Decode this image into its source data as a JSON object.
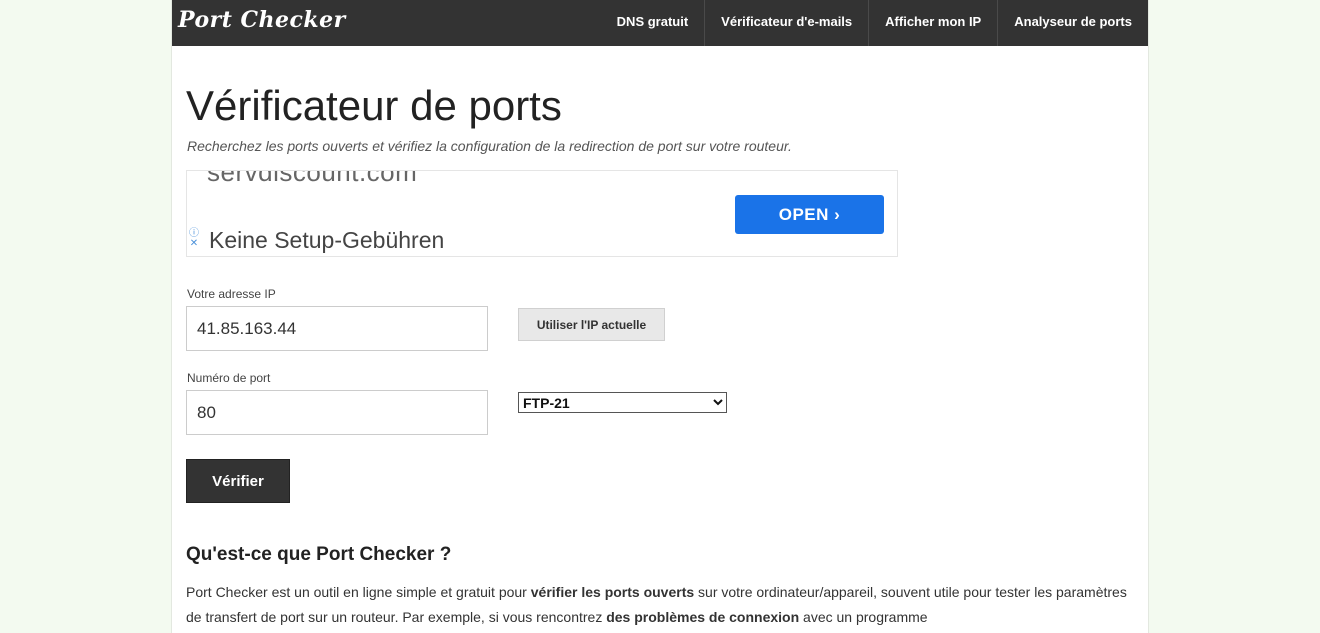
{
  "nav": {
    "logo": "Port Checker",
    "links": [
      "DNS gratuit",
      "Vérificateur d'e-mails",
      "Afficher mon IP",
      "Analyseur de ports"
    ]
  },
  "main": {
    "title": "Vérificateur de ports",
    "subtitle": "Recherchez les ports ouverts et vérifiez la configuration de la redirection de port sur votre routeur."
  },
  "ad": {
    "domain": "servdiscount.com",
    "headline": "Keine Setup-Gebühren",
    "open_label": "OPEN ›",
    "info_icon": "info-icon",
    "close_icon": "close-icon",
    "accent": "#1a73e8"
  },
  "form": {
    "ip_label": "Votre adresse IP",
    "ip_value": "41.85.163.44",
    "use_current_label": "Utiliser l'IP actuelle",
    "port_label": "Numéro de port",
    "port_value": "80",
    "service_selected": "FTP-21",
    "check_label": "Vérifier"
  },
  "about": {
    "heading": "Qu'est-ce que Port Checker ?",
    "p1_a": "Port Checker est un outil en ligne simple et gratuit pour ",
    "p1_b": "vérifier les ports ouverts",
    "p1_c": " sur votre ordinateur/appareil, souvent utile pour tester les paramètres de transfert de port sur un routeur. Par exemple, si vous rencontrez ",
    "p1_d": "des problèmes de connexion",
    "p1_e": " avec un programme"
  }
}
